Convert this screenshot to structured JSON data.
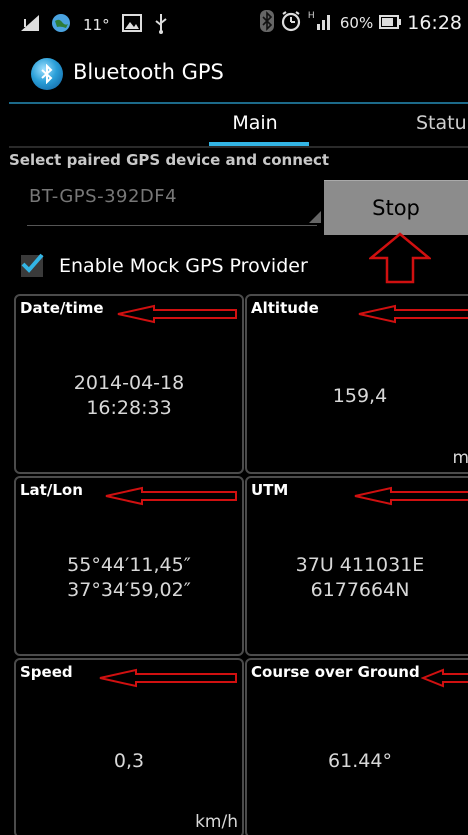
{
  "statusbar": {
    "temperature": "11°",
    "battery_percent": "60%",
    "time": "16:28",
    "icons": [
      "signal-icon",
      "globe-icon",
      "image-icon",
      "usb-icon",
      "bluetooth-icon",
      "alarm-icon",
      "network-icon",
      "battery-icon"
    ]
  },
  "app": {
    "title": "Bluetooth GPS"
  },
  "tabs": {
    "main": "Main",
    "status": "Statu"
  },
  "device": {
    "prompt": "Select paired GPS device and connect",
    "selected": "BT-GPS-392DF4",
    "stop_label": "Stop"
  },
  "mock": {
    "label": "Enable Mock GPS Provider",
    "checked": true
  },
  "tiles": {
    "datetime": {
      "title": "Date/time",
      "line1": "2014-04-18",
      "line2": "16:28:33"
    },
    "altitude": {
      "title": "Altitude",
      "value": "159,4",
      "unit": "m"
    },
    "latlon": {
      "title": "Lat/Lon",
      "line1": "55°44′11,45″",
      "line2": "37°34′59,02″"
    },
    "utm": {
      "title": "UTM",
      "line1": "37U 411031E",
      "line2": "6177664N"
    },
    "speed": {
      "title": "Speed",
      "value": "0,3",
      "unit": "km/h"
    },
    "course": {
      "title": "Course over Ground",
      "value": "61.44°"
    }
  },
  "colors": {
    "accent": "#33b5e5",
    "annotation": "#d01010",
    "button": "#8c8c8c"
  }
}
